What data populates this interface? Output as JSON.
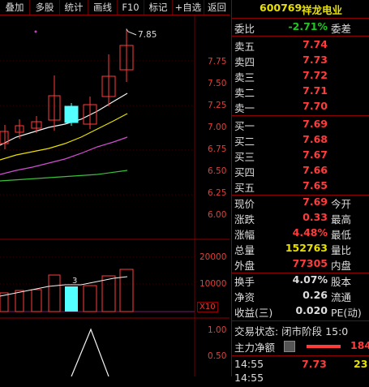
{
  "toolbar": [
    "叠加",
    "多股",
    "统计",
    "画线",
    "F10",
    "标记",
    "+自选",
    "返回"
  ],
  "chart": {
    "price_ticks": [
      "7.75",
      "7.50",
      "7.25",
      "7.00",
      "6.75",
      "6.50",
      "6.25",
      "6.00"
    ],
    "high_label": "7.85",
    "volume_ticks": [
      "20000",
      "10000"
    ],
    "volume_unit": "X10",
    "vol_marker": "3",
    "indicator_ticks": [
      "1.00",
      "0.50"
    ]
  },
  "stock": {
    "code": "600769",
    "name": "祥龙电业"
  },
  "ratio": {
    "label": "委比",
    "value": "-2.71%",
    "diff_label": "委差"
  },
  "sell": [
    {
      "label": "卖五",
      "price": "7.74"
    },
    {
      "label": "卖四",
      "price": "7.73"
    },
    {
      "label": "卖三",
      "price": "7.72"
    },
    {
      "label": "卖二",
      "price": "7.71"
    },
    {
      "label": "卖一",
      "price": "7.70"
    }
  ],
  "buy": [
    {
      "label": "买一",
      "price": "7.69"
    },
    {
      "label": "买二",
      "price": "7.68"
    },
    {
      "label": "买三",
      "price": "7.67"
    },
    {
      "label": "买四",
      "price": "7.66"
    },
    {
      "label": "买五",
      "price": "7.65"
    }
  ],
  "quote": [
    {
      "label": "现价",
      "value": "7.69",
      "label2": "今开"
    },
    {
      "label": "涨跌",
      "value": "0.33",
      "label2": "最高"
    },
    {
      "label": "涨幅",
      "value": "4.48%",
      "label2": "最低"
    },
    {
      "label": "总量",
      "value": "152763",
      "label2": "量比"
    },
    {
      "label": "外盘",
      "value": "77305",
      "label2": "内盘"
    }
  ],
  "stats": [
    {
      "label": "换手",
      "value": "4.07%",
      "label2": "股本"
    },
    {
      "label": "净资",
      "value": "0.26",
      "label2": "流通"
    },
    {
      "label": "收益(三)",
      "value": "0.020",
      "label2": "PE(动)"
    }
  ],
  "trade_status": "交易状态: 闭市阶段 15:0",
  "main_flow": {
    "label": "主力净额",
    "value": "184"
  },
  "ticks": [
    {
      "time": "14:55",
      "price": "7.73",
      "vol": "23"
    },
    {
      "time": "14:55",
      "price": "",
      "vol": ""
    }
  ],
  "colors": {
    "up": "#ff3b3b",
    "down": "#1ec81e",
    "grid": "#8b0000",
    "candle_down": "#54ffff"
  }
}
